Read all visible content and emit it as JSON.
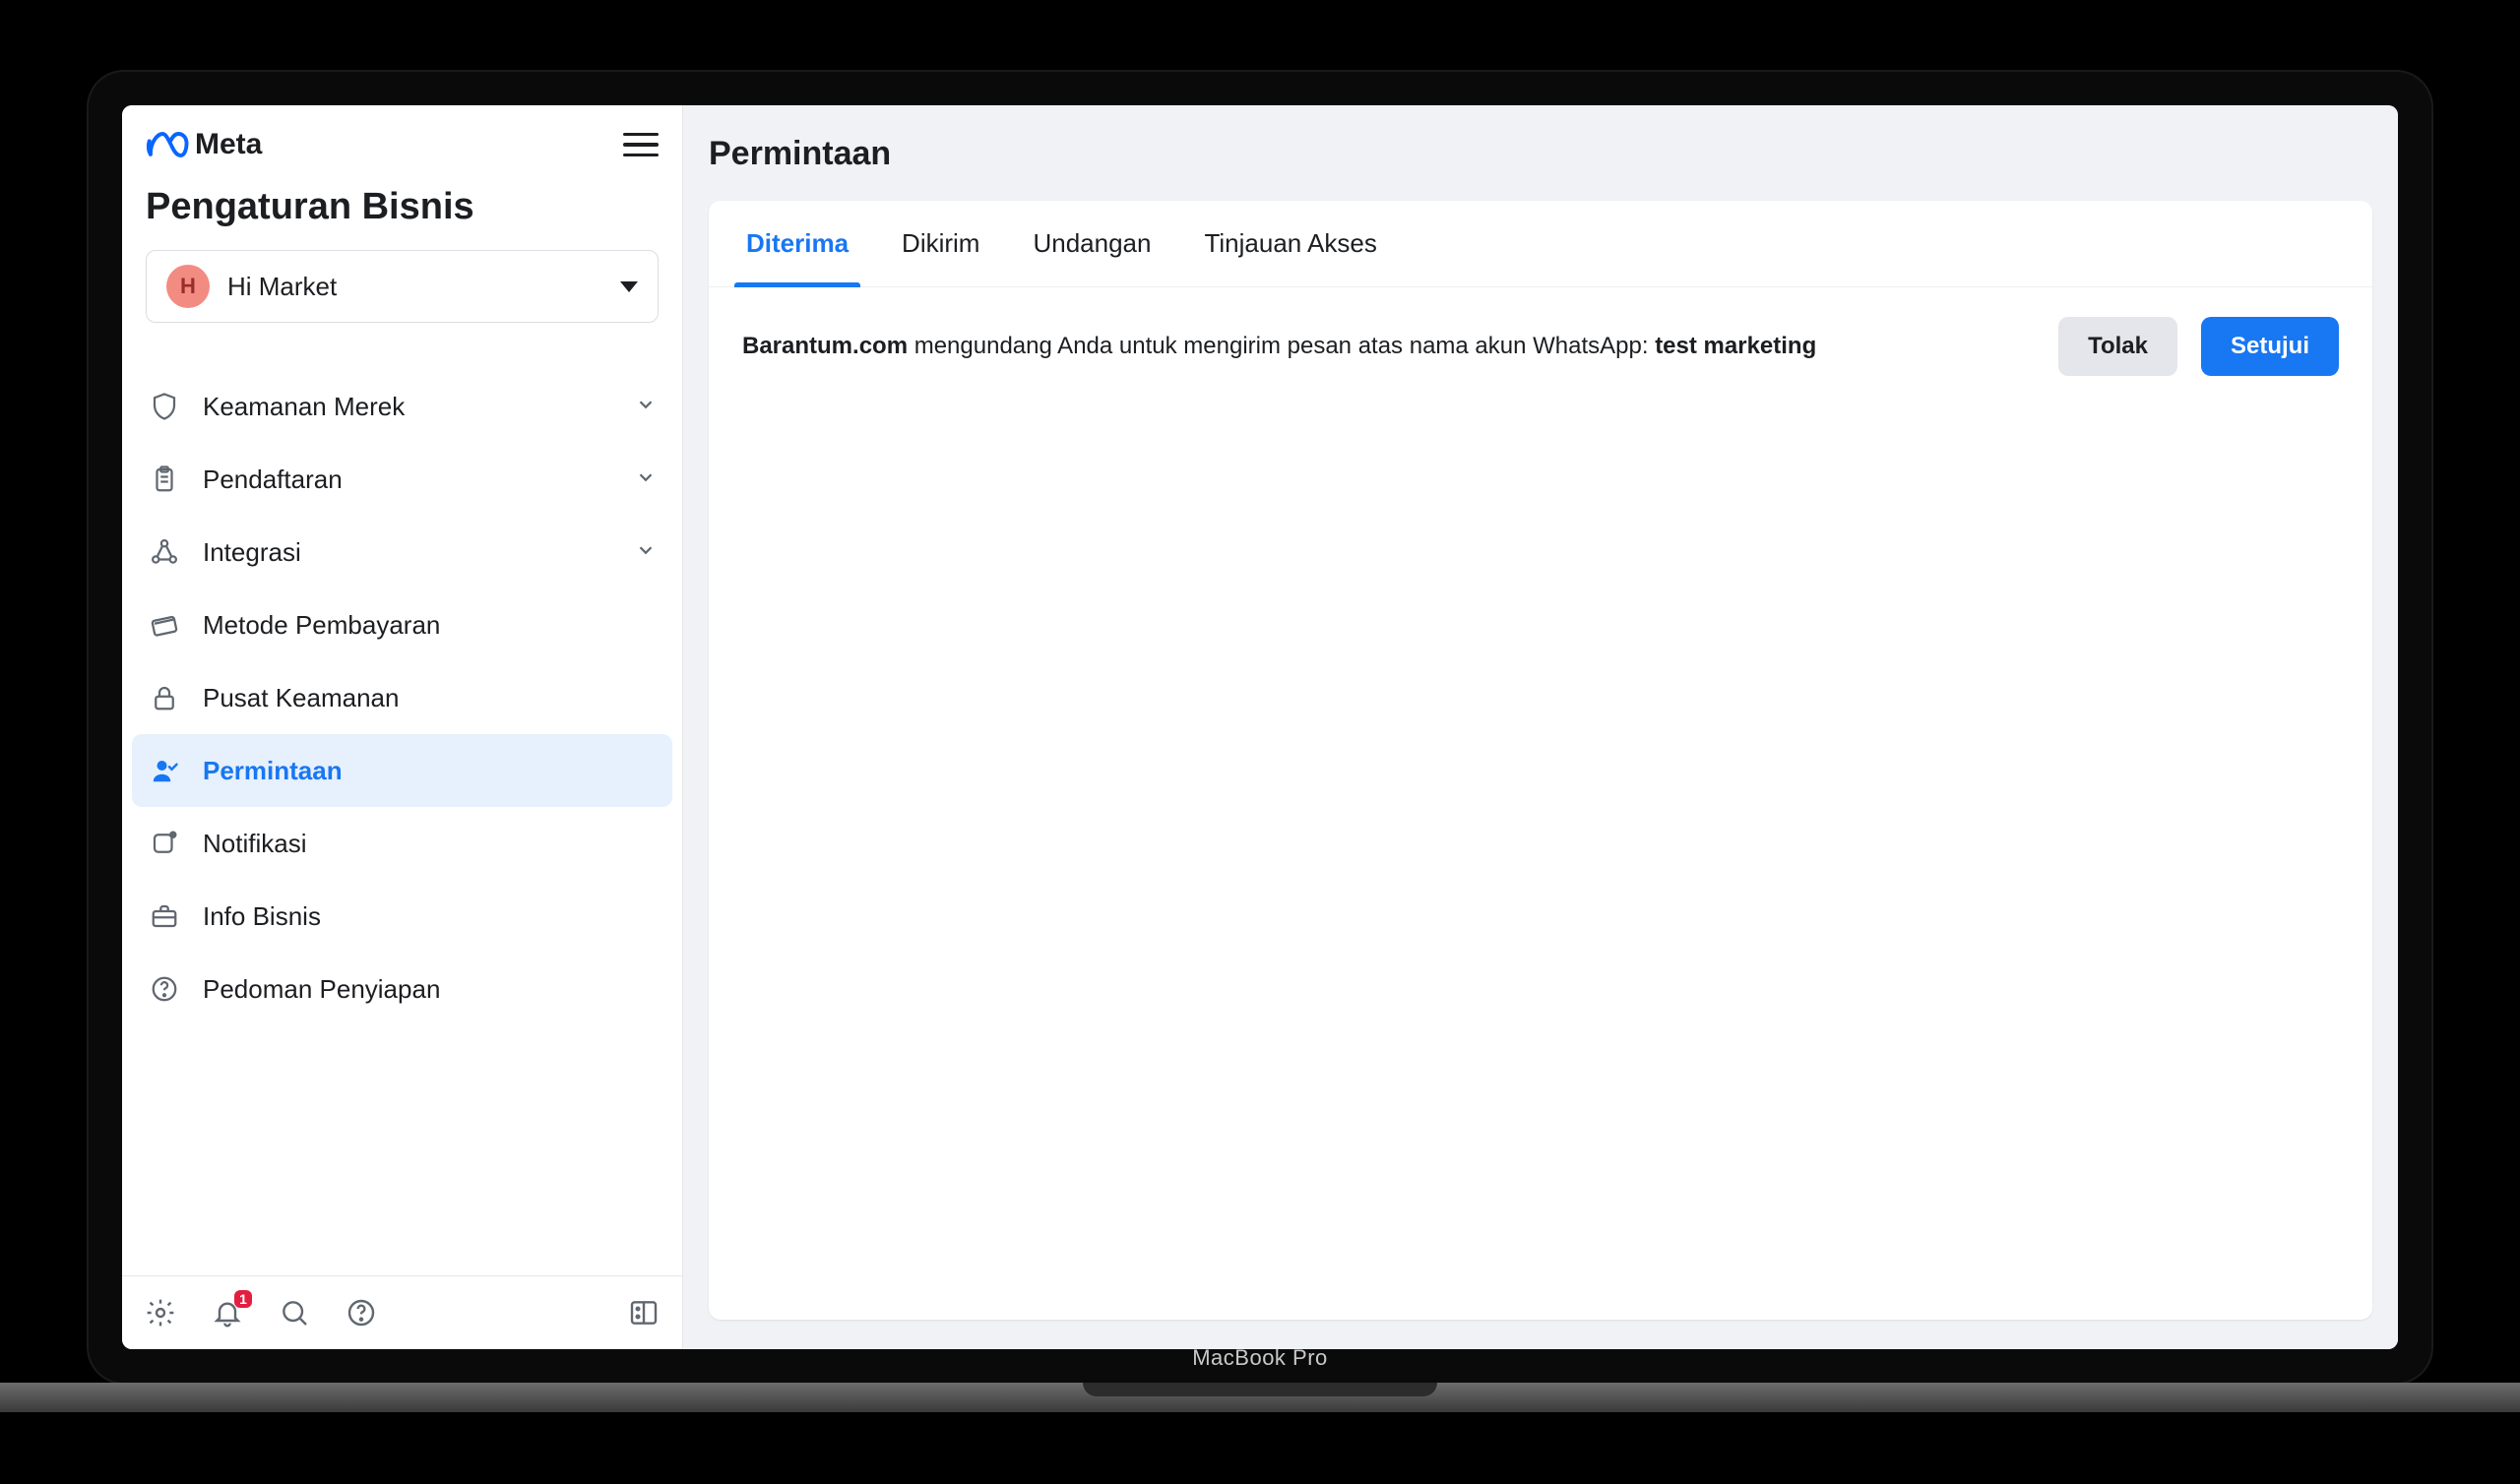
{
  "brand": "Meta",
  "sectionTitle": "Pengaturan Bisnis",
  "account": {
    "initial": "H",
    "name": "Hi Market"
  },
  "nav": {
    "security": "Keamanan Merek",
    "registration": "Pendaftaran",
    "integration": "Integrasi",
    "payment": "Metode Pembayaran",
    "securityCenter": "Pusat Keamanan",
    "requests": "Permintaan",
    "notifications": "Notifikasi",
    "bizinfo": "Info Bisnis",
    "setupGuide": "Pedoman Penyiapan"
  },
  "notificationBadge": "1",
  "page": {
    "title": "Permintaan",
    "tabs": {
      "received": "Diterima",
      "sent": "Dikirim",
      "invitations": "Undangan",
      "accessReview": "Tinjauan Akses"
    },
    "request": {
      "inviter": "Barantum.com",
      "midText": " mengundang Anda untuk mengirim pesan atas nama akun WhatsApp: ",
      "target": "test marketing",
      "rejectLabel": "Tolak",
      "approveLabel": "Setujui"
    }
  },
  "deviceLabel": "MacBook Pro"
}
